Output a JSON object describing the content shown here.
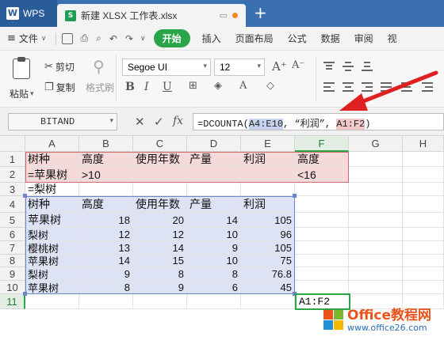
{
  "title_bar": {
    "app_tab": "WPS",
    "doc_tab": "新建 XLSX 工作表.xlsx",
    "accent": "#3a6fb0",
    "new_tab_glyph": "+"
  },
  "menu": {
    "file_label": "文件",
    "start_label": "开始",
    "items": [
      "插入",
      "页面布局",
      "公式",
      "数据",
      "审阅",
      "视"
    ]
  },
  "ribbon": {
    "paste_label": "粘贴",
    "cut_label": "剪切",
    "copy_label": "复制",
    "format_painter_label": "格式刷",
    "font_name": "Segoe UI",
    "font_size": "12",
    "bold": "B",
    "italic": "I",
    "underline": "U"
  },
  "formula_bar": {
    "name_box": "BITAND",
    "cancel_glyph": "✕",
    "confirm_glyph": "✓",
    "fx_label": "fx",
    "formula_prefix": "=DCOUNTA(",
    "ref_database": "A4:E10",
    "formula_mid": ", “利润”, ",
    "ref_criteria": "A1:F2",
    "formula_suffix": ")"
  },
  "grid": {
    "columns": [
      "A",
      "B",
      "C",
      "D",
      "E",
      "F",
      "G",
      "H"
    ],
    "rows": [
      "1",
      "2",
      "3",
      "4",
      "5",
      "6",
      "7",
      "8",
      "9",
      "10",
      "11"
    ],
    "criteria_headers": [
      "树种",
      "高度",
      "使用年数",
      "产量",
      "利润",
      "高度"
    ],
    "criteria_row2": [
      "=苹果树",
      ">10",
      "",
      "",
      "",
      "<16"
    ],
    "criteria_row3": "=梨树",
    "db_headers": [
      "树种",
      "高度",
      "使用年数",
      "产量",
      "利润"
    ],
    "db_rows": [
      [
        "苹果树",
        "18",
        "20",
        "14",
        "105"
      ],
      [
        "梨树",
        "12",
        "12",
        "10",
        "96"
      ],
      [
        "樱桃树",
        "13",
        "14",
        "9",
        "105"
      ],
      [
        "苹果树",
        "14",
        "15",
        "10",
        "75"
      ],
      [
        "梨树",
        "9",
        "8",
        "8",
        "76.8"
      ],
      [
        "苹果树",
        "8",
        "9",
        "6",
        "45"
      ]
    ],
    "active_cell_text": "A1:F2"
  },
  "watermark": {
    "line1": "Office教程网",
    "line2": "www.office26.com"
  },
  "colors": {
    "criteria_fill": "#f6dada",
    "criteria_border": "#cf6a6a",
    "database_fill": "#dde3f5",
    "database_border": "#6c86c8",
    "active_border": "#2aa548",
    "arrow": "#e02020"
  }
}
